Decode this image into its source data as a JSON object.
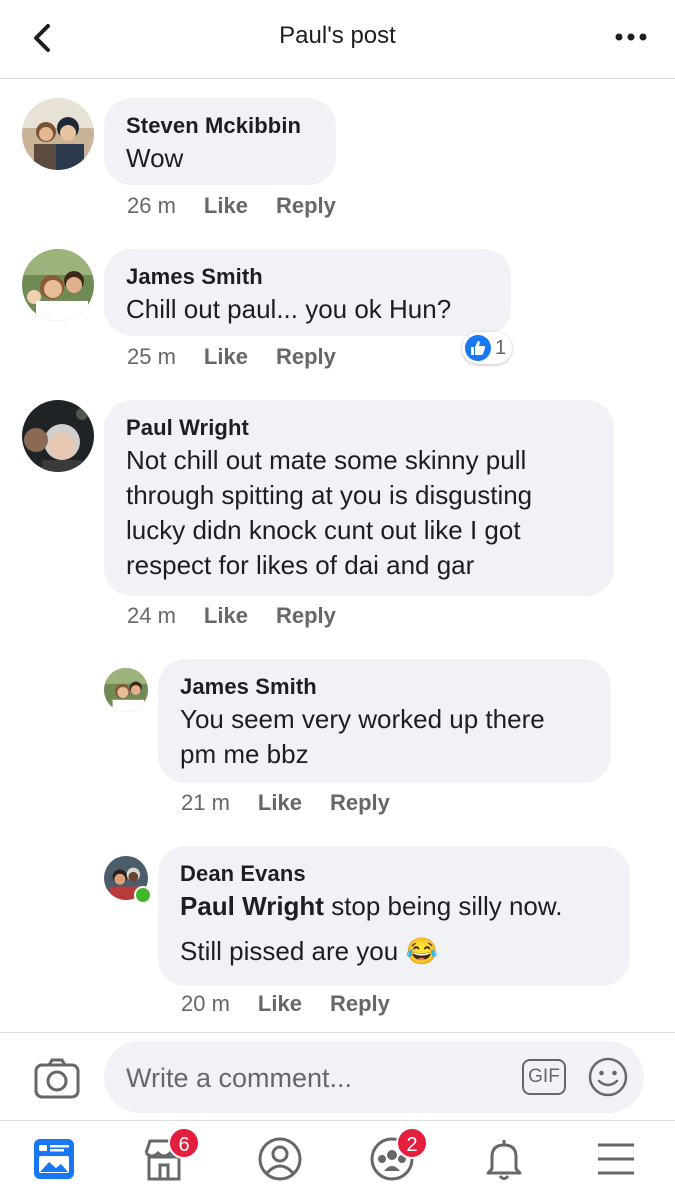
{
  "header": {
    "title": "Paul's post"
  },
  "comments": [
    {
      "author": "Steven Mckibbin",
      "lines": [
        "Wow"
      ],
      "time": "26 m",
      "like": "Like",
      "reply": "Reply"
    },
    {
      "author": "James Smith",
      "lines": [
        "Chill out paul... you ok Hun?"
      ],
      "time": "25 m",
      "like": "Like",
      "reply": "Reply",
      "reaction_count": "1"
    },
    {
      "author": "Paul Wright",
      "lines": [
        "Not chill out mate some skinny pull",
        "through spitting at you is disgusting",
        "lucky didn knock cunt out like I got",
        "respect for likes of dai and gar"
      ],
      "time": "24 m",
      "like": "Like",
      "reply": "Reply"
    }
  ],
  "replies": [
    {
      "author": "James Smith",
      "lines": [
        "You seem very worked up there",
        "pm me bbz"
      ],
      "time": "21 m",
      "like": "Like",
      "reply": "Reply"
    },
    {
      "author": "Dean Evans",
      "mention": "Paul Wright",
      "line1_rest": " stop being silly now.",
      "line2": "Still pissed are you",
      "emoji": "😂",
      "time": "20 m",
      "like": "Like",
      "reply": "Reply"
    }
  ],
  "composer": {
    "placeholder": "Write a comment...",
    "gif_label": "GIF"
  },
  "nav": {
    "marketplace_badge": "6",
    "groups_badge": "2"
  },
  "colors": {
    "accent": "#1877f2",
    "bubble": "#f0f2f5",
    "badge": "#e41e3f",
    "online": "#42b72a"
  },
  "icons": [
    "back-arrow-icon",
    "more-dots-icon",
    "camera-icon",
    "gif-icon",
    "emoji-icon",
    "news-feed-icon",
    "marketplace-icon",
    "profile-icon",
    "groups-icon",
    "notifications-bell-icon",
    "menu-icon",
    "like-thumb-icon"
  ]
}
